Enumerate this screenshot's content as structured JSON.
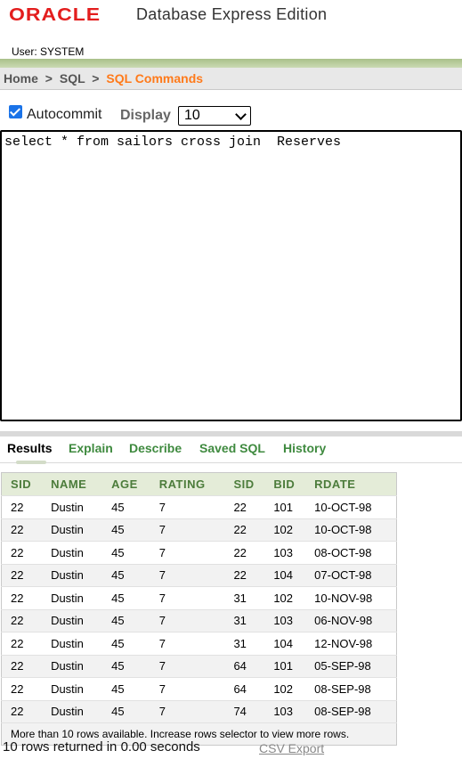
{
  "header": {
    "logo_text": "ORACLE",
    "product_title": "Database Express Edition",
    "user_label": "User:",
    "user_name": "SYSTEM"
  },
  "breadcrumb": {
    "items": [
      "Home",
      "SQL"
    ],
    "separator": ">",
    "current": "SQL Commands"
  },
  "controls": {
    "autocommit_checked": true,
    "autocommit_label": "Autocommit",
    "display_label": "Display",
    "display_value": "10"
  },
  "editor": {
    "text": "select * from sailors cross join  Reserves"
  },
  "tabs": {
    "items": [
      "Results",
      "Explain",
      "Describe",
      "Saved SQL",
      "History"
    ],
    "active": "Results"
  },
  "results": {
    "columns": [
      "SID",
      "NAME",
      "AGE",
      "RATING",
      "SID",
      "BID",
      "RDATE"
    ],
    "rows": [
      [
        "22",
        "Dustin",
        "45",
        "7",
        "22",
        "101",
        "10-OCT-98"
      ],
      [
        "22",
        "Dustin",
        "45",
        "7",
        "22",
        "102",
        "10-OCT-98"
      ],
      [
        "22",
        "Dustin",
        "45",
        "7",
        "22",
        "103",
        "08-OCT-98"
      ],
      [
        "22",
        "Dustin",
        "45",
        "7",
        "22",
        "104",
        "07-OCT-98"
      ],
      [
        "22",
        "Dustin",
        "45",
        "7",
        "31",
        "102",
        "10-NOV-98"
      ],
      [
        "22",
        "Dustin",
        "45",
        "7",
        "31",
        "103",
        "06-NOV-98"
      ],
      [
        "22",
        "Dustin",
        "45",
        "7",
        "31",
        "104",
        "12-NOV-98"
      ],
      [
        "22",
        "Dustin",
        "45",
        "7",
        "64",
        "101",
        "05-SEP-98"
      ],
      [
        "22",
        "Dustin",
        "45",
        "7",
        "64",
        "102",
        "08-SEP-98"
      ],
      [
        "22",
        "Dustin",
        "45",
        "7",
        "74",
        "103",
        "08-SEP-98"
      ]
    ],
    "more_rows_note": "More than 10 rows available. Increase rows selector to view more rows."
  },
  "status": {
    "summary": "10 rows returned in 0.00 seconds",
    "csv_export": "CSV Export"
  },
  "colors": {
    "oracle_red": "#e31d1d",
    "current_crumb": "#ff7a1a",
    "tab_green": "#3f8a3f",
    "header_green": "#4c7c3b"
  }
}
